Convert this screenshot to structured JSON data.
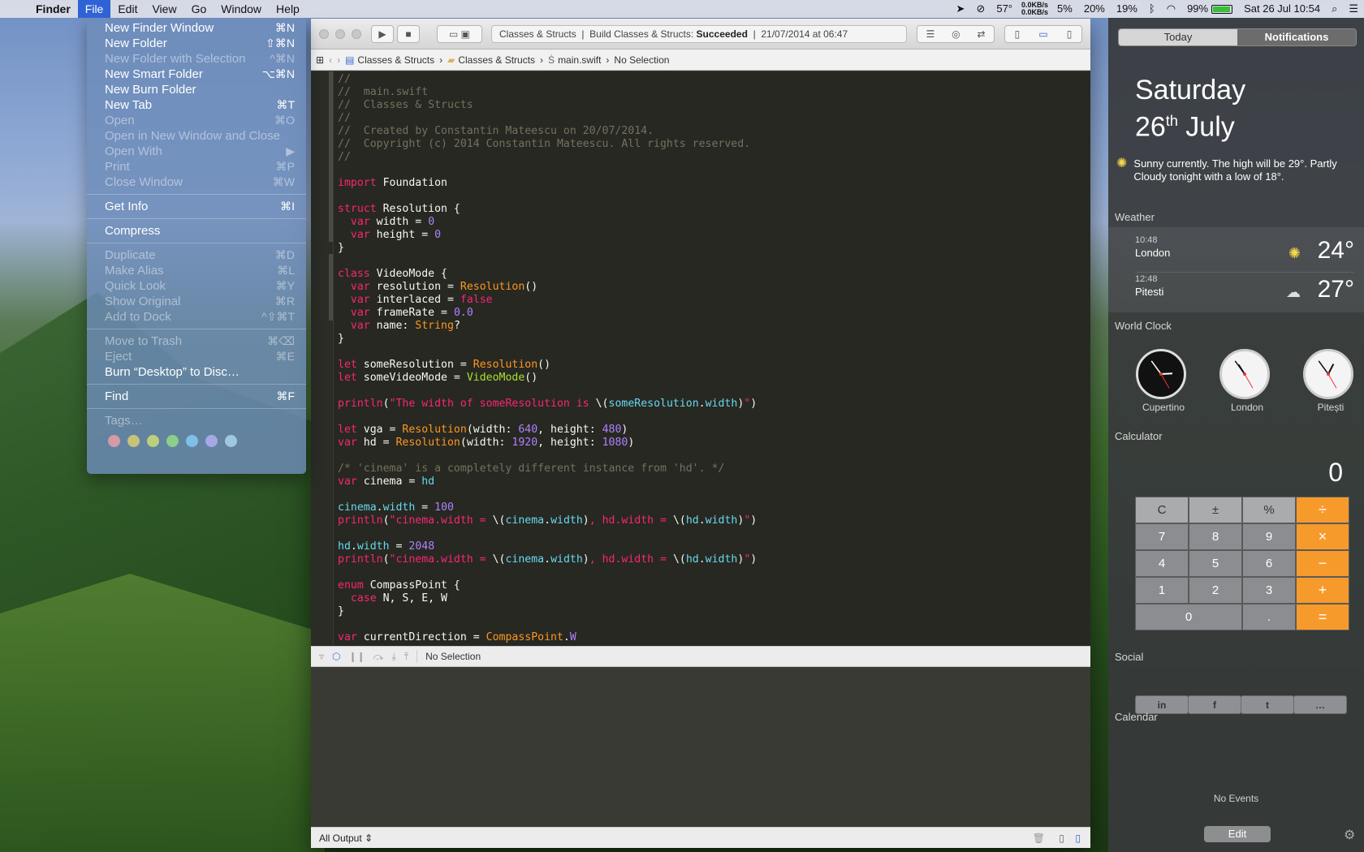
{
  "menubar": {
    "app": "Finder",
    "menus": [
      "File",
      "Edit",
      "View",
      "Go",
      "Window",
      "Help"
    ],
    "status": {
      "temp": "57°",
      "net_up": "0.0KB/s",
      "net_down": "0.0KB/s",
      "cpu": "5%",
      "mem": "20%",
      "disk": "19%",
      "battery": "99%",
      "datetime": "Sat 26 Jul  10:54"
    }
  },
  "file_menu": {
    "group1": [
      {
        "label": "New Finder Window",
        "shortcut": "⌘N",
        "enabled": true
      },
      {
        "label": "New Folder",
        "shortcut": "⇧⌘N",
        "enabled": true
      },
      {
        "label": "New Folder with Selection",
        "shortcut": "^⌘N",
        "enabled": false
      },
      {
        "label": "New Smart Folder",
        "shortcut": "⌥⌘N",
        "enabled": true
      },
      {
        "label": "New Burn Folder",
        "shortcut": "",
        "enabled": true
      },
      {
        "label": "New Tab",
        "shortcut": "⌘T",
        "enabled": true
      },
      {
        "label": "Open",
        "shortcut": "⌘O",
        "enabled": false
      },
      {
        "label": "Open in New Window and Close",
        "shortcut": "",
        "enabled": false
      },
      {
        "label": "Open With",
        "shortcut": "▶",
        "enabled": false
      },
      {
        "label": "Print",
        "shortcut": "⌘P",
        "enabled": false
      },
      {
        "label": "Close Window",
        "shortcut": "⌘W",
        "enabled": false
      }
    ],
    "get_info": {
      "label": "Get Info",
      "shortcut": "⌘I"
    },
    "compress": {
      "label": "Compress"
    },
    "group2": [
      {
        "label": "Duplicate",
        "shortcut": "⌘D"
      },
      {
        "label": "Make Alias",
        "shortcut": "⌘L"
      },
      {
        "label": "Quick Look",
        "shortcut": "⌘Y"
      },
      {
        "label": "Show Original",
        "shortcut": "⌘R"
      },
      {
        "label": "Add to Dock",
        "shortcut": "^⇧⌘T"
      }
    ],
    "group3": [
      {
        "label": "Move to Trash",
        "shortcut": "⌘⌫",
        "enabled": false
      },
      {
        "label": "Eject",
        "shortcut": "⌘E",
        "enabled": false
      },
      {
        "label": "Burn “Desktop” to Disc…",
        "shortcut": "",
        "enabled": true
      }
    ],
    "find": {
      "label": "Find",
      "shortcut": "⌘F"
    },
    "tags_label": "Tags…",
    "tag_colors": [
      "#d49aa6",
      "#c8c27a",
      "#bcd07a",
      "#8ccf8a",
      "#7fbfe8",
      "#a7a7e6",
      "#9fc7dd"
    ]
  },
  "xcode": {
    "activity": {
      "project": "Classes & Structs",
      "build_prefix": "Build Classes & Structs:",
      "build_status": "Succeeded",
      "timestamp": "21/07/2014 at 06:47"
    },
    "breadcrumbs": [
      "Classes & Structs",
      "Classes & Structs",
      "main.swift",
      "No Selection"
    ],
    "debug_selection": "No Selection",
    "output_filter": "All Output"
  },
  "notification_center": {
    "tabs": {
      "today": "Today",
      "notifications": "Notifications"
    },
    "day": "Saturday",
    "date_num": "26",
    "date_sup": "th",
    "month": "July",
    "forecast": "Sunny currently. The high will be 29°. Partly Cloudy tonight with a low of 18°.",
    "weather_title": "Weather",
    "weather": [
      {
        "time": "10:48",
        "city": "London",
        "temp": "24°",
        "icon": "sun-icon"
      },
      {
        "time": "12:48",
        "city": "Pitesti",
        "temp": "27°",
        "icon": "cloud-icon"
      }
    ],
    "clock_title": "World Clock",
    "clocks": [
      {
        "city": "Cupertino",
        "hour": 2.9,
        "minute": 54
      },
      {
        "city": "London",
        "hour": 10.9,
        "minute": 54
      },
      {
        "city": "Pitești",
        "hour": 12.9,
        "minute": 54
      }
    ],
    "calc_title": "Calculator",
    "calc_display": "0",
    "calc_keys": [
      "C",
      "±",
      "%",
      "÷",
      "7",
      "8",
      "9",
      "×",
      "4",
      "5",
      "6",
      "−",
      "1",
      "2",
      "3",
      "+",
      "0",
      ".",
      "="
    ],
    "social_title": "Social",
    "social": [
      "in",
      "f",
      "t",
      "…"
    ],
    "calendar_title": "Calendar",
    "calendar_empty": "No Events",
    "edit": "Edit"
  }
}
